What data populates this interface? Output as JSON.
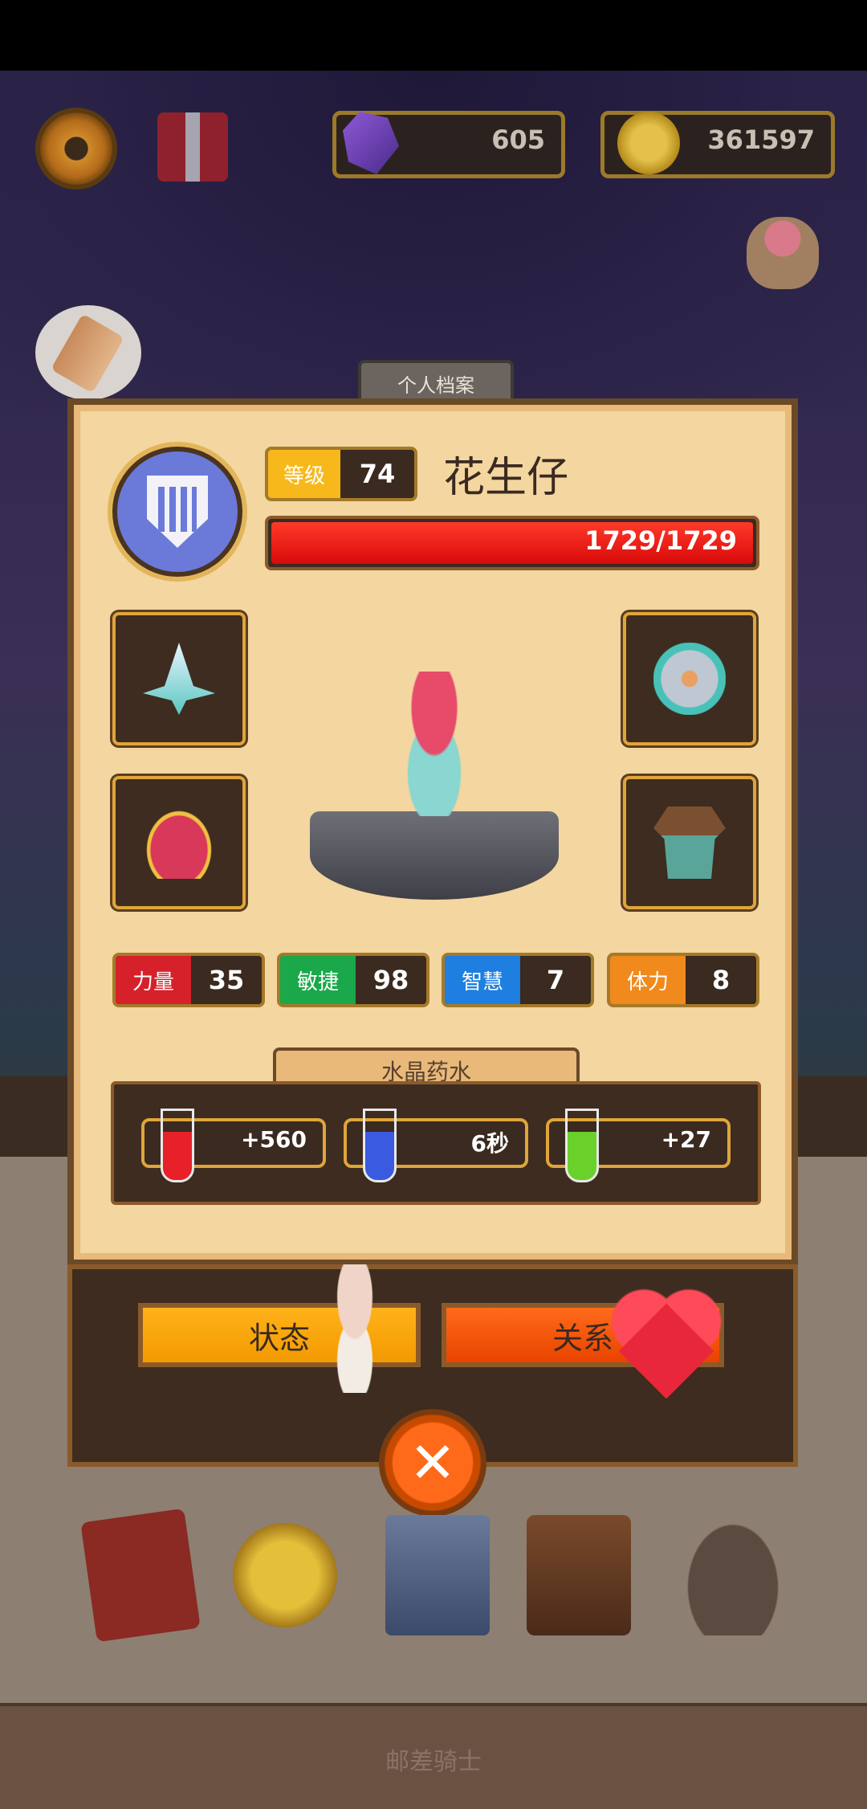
{
  "hud": {
    "gems": "605",
    "coins": "361597"
  },
  "profile": {
    "tab_title": "个人档案",
    "level_label": "等级",
    "level_value": "74",
    "name": "花生仔",
    "hp_text": "1729/1729",
    "hp_fraction": 1.0
  },
  "stats": [
    {
      "label": "力量",
      "value": "35",
      "color": "#d6212a"
    },
    {
      "label": "敏捷",
      "value": "98",
      "color": "#1aa84a"
    },
    {
      "label": "智慧",
      "value": "7",
      "color": "#1e7fe0"
    },
    {
      "label": "体力",
      "value": "8",
      "color": "#f08a1c"
    }
  ],
  "potions": {
    "title": "水晶药水",
    "items": [
      {
        "value": "+560",
        "icon": "red-heal-potion-icon"
      },
      {
        "value": "6秒",
        "icon": "blue-hourglass-potion-icon"
      },
      {
        "value": "+27",
        "icon": "green-attack-potion-icon"
      }
    ]
  },
  "buttons": {
    "status": "状态",
    "relation": "关系",
    "close": "✕"
  },
  "dock_icons": [
    "book-icon",
    "star-medal-icon",
    "card-deck-icon",
    "chest-icon",
    "loot-sack-icon"
  ],
  "footer": {
    "title": "邮差骑士"
  }
}
